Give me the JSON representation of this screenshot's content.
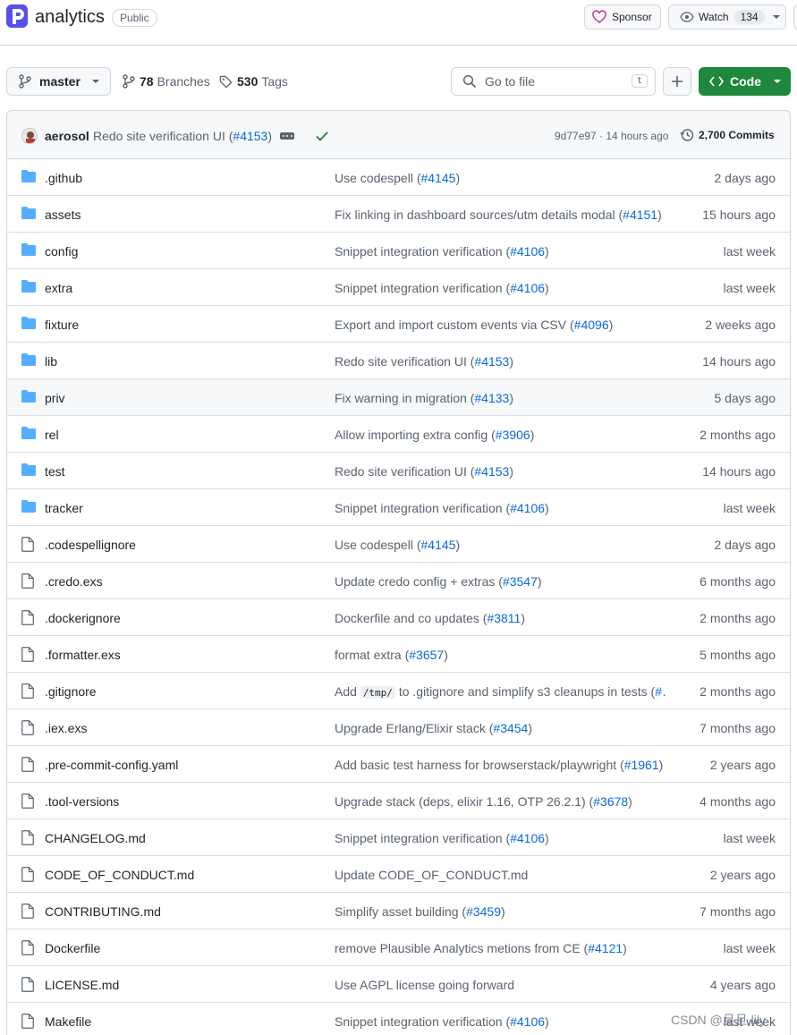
{
  "repo": {
    "name": "analytics",
    "visibility": "Public",
    "sponsor_label": "Sponsor",
    "watch_label": "Watch",
    "watch_count": "134"
  },
  "toolbar": {
    "branch": "master",
    "branches_count": "78",
    "branches_label": "Branches",
    "tags_count": "530",
    "tags_label": "Tags",
    "goto_placeholder": "Go to file",
    "goto_shortcut": "t",
    "code_label": "Code"
  },
  "latest_commit": {
    "author": "aerosol",
    "message": "Redo site verification UI (",
    "pr": "#4153",
    "message_end": ")",
    "sha_time": "9d77e97 · 14 hours ago",
    "commits_count": "2,700 Commits"
  },
  "files": [
    {
      "type": "dir",
      "name": ".github",
      "msg": "Use codespell (",
      "pr": "#4145",
      "end": ")",
      "time": "2 days ago"
    },
    {
      "type": "dir",
      "name": "assets",
      "msg": "Fix linking in dashboard sources/utm details modal (",
      "pr": "#4151",
      "end": ")",
      "time": "15 hours ago"
    },
    {
      "type": "dir",
      "name": "config",
      "msg": "Snippet integration verification (",
      "pr": "#4106",
      "end": ")",
      "time": "last week"
    },
    {
      "type": "dir",
      "name": "extra",
      "msg": "Snippet integration verification (",
      "pr": "#4106",
      "end": ")",
      "time": "last week"
    },
    {
      "type": "dir",
      "name": "fixture",
      "msg": "Export and import custom events via CSV (",
      "pr": "#4096",
      "end": ")",
      "time": "2 weeks ago"
    },
    {
      "type": "dir",
      "name": "lib",
      "msg": "Redo site verification UI (",
      "pr": "#4153",
      "end": ")",
      "time": "14 hours ago"
    },
    {
      "type": "dir",
      "name": "priv",
      "msg": "Fix warning in migration (",
      "pr": "#4133",
      "end": ")",
      "time": "5 days ago",
      "highlight": true
    },
    {
      "type": "dir",
      "name": "rel",
      "msg": "Allow importing extra config (",
      "pr": "#3906",
      "end": ")",
      "time": "2 months ago"
    },
    {
      "type": "dir",
      "name": "test",
      "msg": "Redo site verification UI (",
      "pr": "#4153",
      "end": ")",
      "time": "14 hours ago"
    },
    {
      "type": "dir",
      "name": "tracker",
      "msg": "Snippet integration verification (",
      "pr": "#4106",
      "end": ")",
      "time": "last week"
    },
    {
      "type": "file",
      "name": ".codespellignore",
      "msg": "Use codespell (",
      "pr": "#4145",
      "end": ")",
      "time": "2 days ago"
    },
    {
      "type": "file",
      "name": ".credo.exs",
      "msg": "Update credo config + extras (",
      "pr": "#3547",
      "end": ")",
      "time": "6 months ago"
    },
    {
      "type": "file",
      "name": ".dockerignore",
      "msg": "Dockerfile and co updates (",
      "pr": "#3811",
      "end": ")",
      "time": "2 months ago"
    },
    {
      "type": "file",
      "name": ".formatter.exs",
      "msg": "format extra (",
      "pr": "#3657",
      "end": ")",
      "time": "5 months ago"
    },
    {
      "type": "file",
      "name": ".gitignore",
      "msg": "Add ",
      "code": "/tmp/",
      "msg2": " to .gitignore and simplify s3 cleanups in tests (",
      "pr": "#…",
      "end": "",
      "time": "2 months ago"
    },
    {
      "type": "file",
      "name": ".iex.exs",
      "msg": "Upgrade Erlang/Elixir stack (",
      "pr": "#3454",
      "end": ")",
      "time": "7 months ago"
    },
    {
      "type": "file",
      "name": ".pre-commit-config.yaml",
      "msg": "Add basic test harness for browserstack/playwright (",
      "pr": "#1961",
      "end": ")",
      "time": "2 years ago"
    },
    {
      "type": "file",
      "name": ".tool-versions",
      "msg": "Upgrade stack (deps, elixir 1.16, OTP 26.2.1) (",
      "pr": "#3678",
      "end": ")",
      "time": "4 months ago"
    },
    {
      "type": "file",
      "name": "CHANGELOG.md",
      "msg": "Snippet integration verification (",
      "pr": "#4106",
      "end": ")",
      "time": "last week"
    },
    {
      "type": "file",
      "name": "CODE_OF_CONDUCT.md",
      "msg": "Update CODE_OF_CONDUCT.md",
      "pr": "",
      "end": "",
      "time": "2 years ago"
    },
    {
      "type": "file",
      "name": "CONTRIBUTING.md",
      "msg": "Simplify asset building (",
      "pr": "#3459",
      "end": ")",
      "time": "7 months ago"
    },
    {
      "type": "file",
      "name": "Dockerfile",
      "msg": "remove Plausible Analytics metions from CE (",
      "pr": "#4121",
      "end": ")",
      "time": "last week"
    },
    {
      "type": "file",
      "name": "LICENSE.md",
      "msg": "Use AGPL license going forward",
      "pr": "",
      "end": "",
      "time": "4 years ago"
    },
    {
      "type": "file",
      "name": "Makefile",
      "msg": "Snippet integration verification (",
      "pr": "#4106",
      "end": ")",
      "time": "last week"
    }
  ],
  "watermark": "CSDN @旦旦.lily"
}
